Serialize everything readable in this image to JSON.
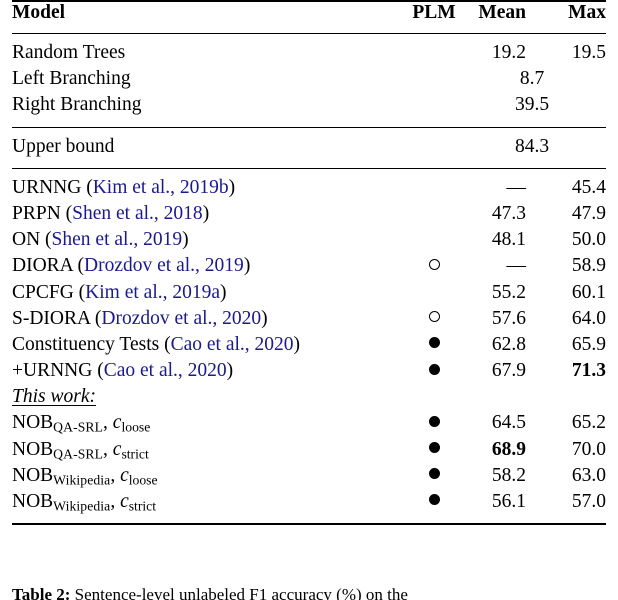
{
  "table": {
    "columns": [
      "Model",
      "PLM",
      "Mean",
      "Max"
    ],
    "rules": {
      "top": true,
      "after_header": true,
      "mid": true,
      "bottom": true
    },
    "markers": {
      "filled": "●",
      "open": "○",
      "none": ""
    },
    "dash": "—",
    "groups": [
      {
        "name": "baselines",
        "rows": [
          {
            "model": "Random Trees",
            "plm": "",
            "mean": "19.2",
            "max": "19.5",
            "span": false
          },
          {
            "model": "Left Branching",
            "plm": "",
            "span_value": "8.7",
            "span": true
          },
          {
            "model": "Right Branching",
            "plm": "",
            "span_value": "39.5",
            "span": true
          }
        ]
      },
      {
        "name": "upper-bound",
        "rows": [
          {
            "model": "Upper bound",
            "plm": "",
            "span_value": "84.3",
            "span": true
          }
        ]
      },
      {
        "name": "prior-work",
        "rows": [
          {
            "model": "URNNG",
            "citation": "Kim et al., 2019b",
            "plm": "none",
            "mean": "—",
            "max": "45.4",
            "mean_bold": false,
            "max_bold": false
          },
          {
            "model": "PRPN",
            "citation": "Shen et al., 2018",
            "plm": "none",
            "mean": "47.3",
            "max": "47.9",
            "mean_bold": false,
            "max_bold": false
          },
          {
            "model": "ON",
            "citation": "Shen et al., 2019",
            "plm": "none",
            "mean": "48.1",
            "max": "50.0",
            "mean_bold": false,
            "max_bold": false
          },
          {
            "model": "DIORA",
            "citation": "Drozdov et al., 2019",
            "plm": "open",
            "mean": "—",
            "max": "58.9",
            "mean_bold": false,
            "max_bold": false
          },
          {
            "model": "CPCFG",
            "citation": "Kim et al., 2019a",
            "plm": "none",
            "mean": "55.2",
            "max": "60.1",
            "mean_bold": false,
            "max_bold": false
          },
          {
            "model": "S-DIORA",
            "citation": "Drozdov et al., 2020",
            "plm": "open",
            "mean": "57.6",
            "max": "64.0",
            "mean_bold": false,
            "max_bold": false
          },
          {
            "model": "Constituency Tests",
            "citation": "Cao et al., 2020",
            "plm": "filled",
            "mean": "62.8",
            "max": "65.9",
            "mean_bold": false,
            "max_bold": false
          },
          {
            "model": "+URNNG",
            "citation": "Cao et al., 2020",
            "plm": "filled",
            "mean": "67.9",
            "max": "71.3",
            "mean_bold": false,
            "max_bold": true,
            "indent": true
          }
        ]
      },
      {
        "name": "this-work",
        "heading": "This work:",
        "rows": [
          {
            "model_base": "NOB",
            "model_sub": "QA-SRL",
            "model_tail_var": "c",
            "model_tail_sub": "loose",
            "plm": "filled",
            "mean": "64.5",
            "max": "65.2",
            "mean_bold": false,
            "max_bold": false
          },
          {
            "model_base": "NOB",
            "model_sub": "QA-SRL",
            "model_tail_var": "c",
            "model_tail_sub": "strict",
            "plm": "filled",
            "mean": "68.9",
            "max": "70.0",
            "mean_bold": true,
            "max_bold": false
          },
          {
            "model_base": "NOB",
            "model_sub": "Wikipedia",
            "model_tail_var": "c",
            "model_tail_sub": "loose",
            "plm": "filled",
            "mean": "58.2",
            "max": "63.0",
            "mean_bold": false,
            "max_bold": false
          },
          {
            "model_base": "NOB",
            "model_sub": "Wikipedia",
            "model_tail_var": "c",
            "model_tail_sub": "strict",
            "plm": "filled",
            "mean": "56.1",
            "max": "57.0",
            "mean_bold": false,
            "max_bold": false
          }
        ]
      }
    ]
  },
  "caption": {
    "label": "Table 2:",
    "text_start": "Sentence-level unlabeled F1 accuracy (%) on the"
  },
  "colors": {
    "text": "#000000",
    "citation_link": "#1a1a8c",
    "rule": "#000000",
    "background": "#ffffff"
  }
}
